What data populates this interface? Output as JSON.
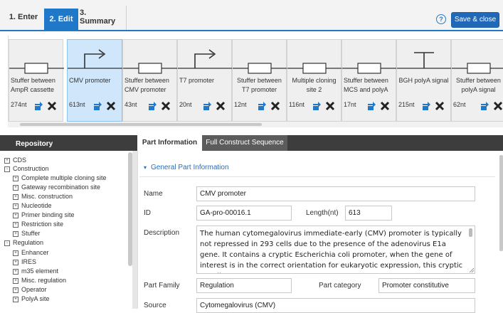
{
  "header": {
    "steps": [
      {
        "label": "1. Enter"
      },
      {
        "label": "2. Edit"
      },
      {
        "label": "3. Summary"
      }
    ],
    "help_glyph": "?",
    "save_label": "Save & close",
    "accent_color": "#1f78c8"
  },
  "parts": [
    {
      "name": "Stuffer between AmpR cassette",
      "length": "274nt",
      "glyph": "stuffer-box"
    },
    {
      "name": "CMV promoter",
      "length": "613nt",
      "glyph": "promoter-arrow",
      "selected": true
    },
    {
      "name": "Stuffer between CMV promoter",
      "length": "43nt",
      "glyph": "stuffer-box"
    },
    {
      "name": "T7 promoter",
      "length": "20nt",
      "glyph": "promoter-arrow"
    },
    {
      "name": "Stuffer between T7 promoter",
      "length": "12nt",
      "glyph": "stuffer-box"
    },
    {
      "name": "Multiple cloning site 2",
      "length": "116nt",
      "glyph": "stuffer-box"
    },
    {
      "name": "Stuffer between MCS and polyA",
      "length": "17nt",
      "glyph": "stuffer-box"
    },
    {
      "name": "BGH polyA signal",
      "length": "215nt",
      "glyph": "terminator-t"
    },
    {
      "name": "Stuffer between polyA signal",
      "length": "62nt",
      "glyph": "stuffer-box"
    }
  ],
  "repository": {
    "title": "Repository",
    "tree": [
      {
        "label": "CDS",
        "level": 0,
        "expanded": false
      },
      {
        "label": "Construction",
        "level": 0,
        "expanded": true
      },
      {
        "label": "Complete multiple cloning site",
        "level": 1,
        "expanded": false
      },
      {
        "label": "Gateway recombination site",
        "level": 1,
        "expanded": false
      },
      {
        "label": "Misc. construction",
        "level": 1,
        "expanded": false
      },
      {
        "label": "Nucleotide",
        "level": 1,
        "expanded": false
      },
      {
        "label": "Primer binding site",
        "level": 1,
        "expanded": false
      },
      {
        "label": "Restriction site",
        "level": 1,
        "expanded": false
      },
      {
        "label": "Stuffer",
        "level": 1,
        "expanded": false
      },
      {
        "label": "Regulation",
        "level": 0,
        "expanded": true
      },
      {
        "label": "Enhancer",
        "level": 1,
        "expanded": false
      },
      {
        "label": "IRES",
        "level": 1,
        "expanded": false
      },
      {
        "label": "m35 element",
        "level": 1,
        "expanded": false
      },
      {
        "label": "Misc. regulation",
        "level": 1,
        "expanded": false
      },
      {
        "label": "Operator",
        "level": 1,
        "expanded": false
      },
      {
        "label": "PolyA site",
        "level": 1,
        "expanded": false
      }
    ]
  },
  "tabs": {
    "part_info": "Part Information",
    "full_construct": "Full Construct Sequence"
  },
  "general": {
    "section_title": "General Part Information",
    "name_label": "Name",
    "name_value": "CMV promoter",
    "id_label": "ID",
    "id_value": "GA-pro-00016.1",
    "length_label": "Length(nt)",
    "length_value": "613",
    "description_label": "Description",
    "description_value": "The human cytomegalovirus immediate-early (CMV) promoter  is typically not repressed in 293 cells due to the presence of the adenovirus E1a gene. It contains a cryptic Escherichia coli promoter, when the gene of interest is in the correct orientation for eukaryotic expression, this cryptic E. coli promoter",
    "family_label": "Part Family",
    "family_value": "Regulation",
    "category_label": "Part category",
    "category_value": "Promoter constitutive",
    "source_label": "Source",
    "source_value": "Cytomegalovirus (CMV)"
  }
}
